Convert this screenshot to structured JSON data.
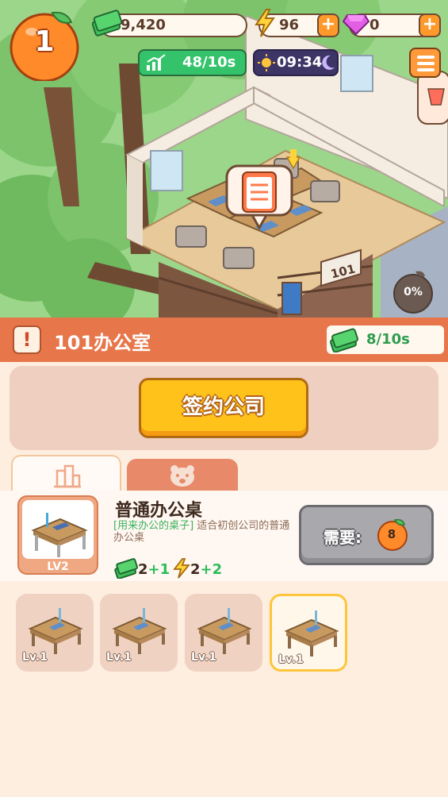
{
  "hud": {
    "level": "1",
    "cash": "9,420",
    "energy": "96",
    "gems": "0",
    "income_rate": "48/10s",
    "clock": "09:34"
  },
  "scene": {
    "door_number": "101",
    "progress_percent": "0%"
  },
  "room": {
    "alert_glyph": "!",
    "title": "101办公室",
    "income": "8/10s"
  },
  "sign_button": {
    "label": "签约公司"
  },
  "tabs": [
    {
      "name": "building-tab",
      "icon": "building-icon",
      "active": true
    },
    {
      "name": "staff-tab",
      "icon": "bear-face-icon",
      "active": false
    }
  ],
  "item": {
    "level": "LV2",
    "name": "普通办公桌",
    "desc_tag": "[用来办公的桌子]",
    "desc_text": "适合初创公司的普通办公桌",
    "cash_base": "2",
    "cash_bonus": "+1",
    "energy_base": "2",
    "energy_bonus": "+2",
    "need_label": "需要:",
    "need_amount": "8"
  },
  "slots": [
    {
      "level": "Lv.1",
      "selected": false
    },
    {
      "level": "Lv.1",
      "selected": false
    },
    {
      "level": "Lv.1",
      "selected": false
    },
    {
      "level": "Lv.1",
      "selected": true
    }
  ],
  "colors": {
    "accent_orange": "#e7764a",
    "button_yellow": "#ffc21a",
    "cash_green": "#2d9c4e",
    "panel_bg": "#fdeee0"
  }
}
